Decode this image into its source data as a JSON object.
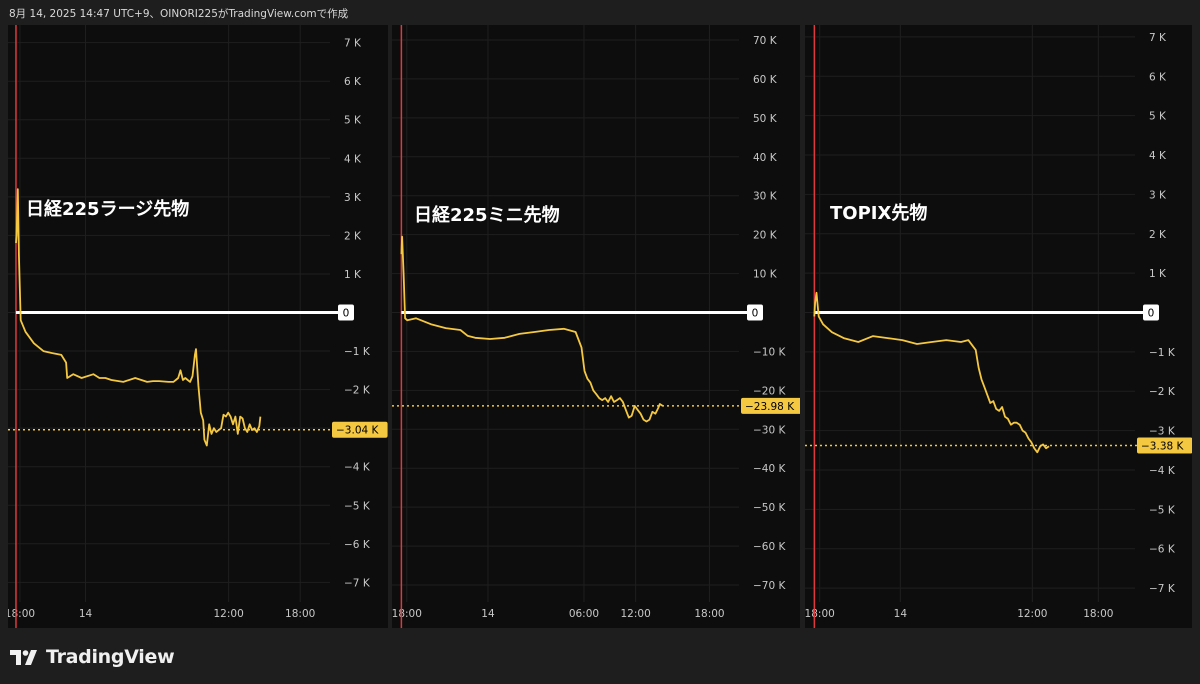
{
  "header": {
    "text": "8月 14, 2025 14:47 UTC+9、OINORI225がTradingView.comで作成"
  },
  "brand": {
    "name": "TradingView"
  },
  "colors": {
    "line": "#f5c842",
    "zero_line": "#ffffff",
    "session_line": "#e0383b",
    "grid": "#1f1f1f",
    "axis_text": "#c8c8c8",
    "panel_bg": "#0d0d0d",
    "page_bg": "#1e1e1e"
  },
  "chart_data": [
    {
      "type": "line",
      "title": "日経225ラージ先物",
      "y_ticks": [
        {
          "v": 7000,
          "label": "7 K"
        },
        {
          "v": 6000,
          "label": "6 K"
        },
        {
          "v": 5000,
          "label": "5 K"
        },
        {
          "v": 4000,
          "label": "4 K"
        },
        {
          "v": 3000,
          "label": "3 K"
        },
        {
          "v": 2000,
          "label": "2 K"
        },
        {
          "v": 1000,
          "label": "1 K"
        },
        {
          "v": 0,
          "label": "0"
        },
        {
          "v": -1000,
          "label": "−1 K"
        },
        {
          "v": -2000,
          "label": "−2 K"
        },
        {
          "v": -3000,
          "label": "−3 K"
        },
        {
          "v": -4000,
          "label": "−4 K"
        },
        {
          "v": -5000,
          "label": "−5 K"
        },
        {
          "v": -6000,
          "label": "−6 K"
        },
        {
          "v": -7000,
          "label": "−7 K"
        }
      ],
      "x_ticks": [
        {
          "t": 0.5,
          "label": "18:00"
        },
        {
          "t": 6,
          "label": "14"
        },
        {
          "t": 18,
          "label": "12:00"
        },
        {
          "t": 24,
          "label": "18:00"
        }
      ],
      "x_range": [
        -0.5,
        26.5
      ],
      "y_range": [
        -7250,
        7250
      ],
      "current_value": -3040,
      "current_label": "−3.04 K",
      "zero_label": "0",
      "series": [
        {
          "x": [
            0,
            0.05,
            0.15,
            0.25,
            0.4,
            0.8,
            1.5,
            2.3,
            3,
            3.8,
            4.2,
            4.3,
            4.8,
            5.5,
            6.5,
            7,
            7.5,
            8,
            9,
            10,
            11,
            11.5,
            12,
            12.8,
            13.2,
            13.4,
            13.6,
            13.8,
            14,
            14.2,
            14.4,
            14.6,
            14.8,
            15,
            15.1,
            15.3,
            15.5,
            15.7,
            15.8,
            16,
            16.2,
            16.4,
            16.6,
            16.8,
            17,
            17.2,
            17.4,
            17.6,
            17.8,
            18,
            18.2,
            18.4,
            18.6,
            18.8,
            19,
            19.2,
            19.4,
            19.6,
            19.8,
            20,
            20.2,
            20.4,
            20.5
          ],
          "y": [
            1800,
            2000,
            3200,
            1500,
            -200,
            -500,
            -800,
            -1000,
            -1050,
            -1100,
            -1300,
            -1700,
            -1600,
            -1700,
            -1600,
            -1700,
            -1700,
            -1750,
            -1800,
            -1700,
            -1800,
            -1780,
            -1780,
            -1800,
            -1800,
            -1750,
            -1700,
            -1500,
            -1750,
            -1700,
            -1750,
            -1800,
            -1650,
            -1100,
            -950,
            -1900,
            -2600,
            -2800,
            -3300,
            -3450,
            -2900,
            -3150,
            -3000,
            -3100,
            -3050,
            -3000,
            -2650,
            -2700,
            -2600,
            -2700,
            -2900,
            -2700,
            -3150,
            -2700,
            -2750,
            -3000,
            -3100,
            -2900,
            -3050,
            -3000,
            -3100,
            -2950,
            -2700
          ]
        }
      ]
    },
    {
      "type": "line",
      "title": "日経225ミニ先物",
      "y_ticks": [
        {
          "v": 70000,
          "label": "70 K"
        },
        {
          "v": 60000,
          "label": "60 K"
        },
        {
          "v": 50000,
          "label": "50 K"
        },
        {
          "v": 40000,
          "label": "40 K"
        },
        {
          "v": 30000,
          "label": "30 K"
        },
        {
          "v": 20000,
          "label": "20 K"
        },
        {
          "v": 10000,
          "label": "10 K"
        },
        {
          "v": 0,
          "label": "0"
        },
        {
          "v": -10000,
          "label": "−10 K"
        },
        {
          "v": -20000,
          "label": "−20 K"
        },
        {
          "v": -30000,
          "label": "−30 K"
        },
        {
          "v": -40000,
          "label": "−40 K"
        },
        {
          "v": -50000,
          "label": "−50 K"
        },
        {
          "v": -60000,
          "label": "−60 K"
        },
        {
          "v": -70000,
          "label": "−70 K"
        }
      ],
      "x_ticks": [
        {
          "t": 0.5,
          "label": "18:00"
        },
        {
          "t": 6,
          "label": "14"
        },
        {
          "t": 12.5,
          "label": "06:00"
        },
        {
          "t": 16,
          "label": "12:00"
        },
        {
          "t": 21,
          "label": "18:00"
        }
      ],
      "x_range": [
        -0.5,
        23
      ],
      "y_range": [
        -71800,
        71800
      ],
      "current_value": -23980,
      "current_label": "−23.98 K",
      "zero_label": "0",
      "series": [
        {
          "x": [
            0,
            0.05,
            0.15,
            0.25,
            0.4,
            1,
            2,
            3,
            4,
            4.5,
            5,
            6,
            7,
            8,
            9,
            10,
            11,
            11.8,
            12.2,
            12.4,
            12.6,
            12.8,
            13,
            13.2,
            13.4,
            13.6,
            13.8,
            14,
            14.2,
            14.4,
            14.6,
            14.8,
            15,
            15.2,
            15.4,
            15.6,
            15.8,
            16,
            16.2,
            16.4,
            16.6,
            16.8,
            17,
            17.2,
            17.4,
            17.5,
            17.7
          ],
          "y": [
            15000,
            19500,
            10000,
            -1500,
            -2000,
            -1500,
            -3000,
            -4000,
            -4500,
            -6000,
            -6500,
            -6800,
            -6500,
            -5500,
            -5000,
            -4500,
            -4200,
            -5000,
            -9000,
            -15000,
            -17000,
            -18000,
            -20000,
            -21000,
            -22000,
            -22500,
            -22000,
            -23000,
            -21500,
            -23000,
            -22500,
            -22000,
            -23000,
            -25000,
            -27000,
            -26500,
            -24000,
            -25000,
            -26000,
            -27500,
            -28000,
            -27500,
            -25500,
            -26000,
            -24500,
            -23500,
            -24000
          ]
        }
      ]
    },
    {
      "type": "line",
      "title": "TOPIX先物",
      "y_ticks": [
        {
          "v": 7000,
          "label": "7 K"
        },
        {
          "v": 6000,
          "label": "6 K"
        },
        {
          "v": 5000,
          "label": "5 K"
        },
        {
          "v": 4000,
          "label": "4 K"
        },
        {
          "v": 3000,
          "label": "3 K"
        },
        {
          "v": 2000,
          "label": "2 K"
        },
        {
          "v": 1000,
          "label": "1 K"
        },
        {
          "v": 0,
          "label": "0"
        },
        {
          "v": -1000,
          "label": "−1 K"
        },
        {
          "v": -2000,
          "label": "−2 K"
        },
        {
          "v": -3000,
          "label": "−3 K"
        },
        {
          "v": -4000,
          "label": "−4 K"
        },
        {
          "v": -5000,
          "label": "−5 K"
        },
        {
          "v": -6000,
          "label": "−6 K"
        },
        {
          "v": -7000,
          "label": "−7 K"
        }
      ],
      "x_ticks": [
        {
          "t": 0.5,
          "label": "18:00"
        },
        {
          "t": 6,
          "label": "14"
        },
        {
          "t": 15,
          "label": "12:00"
        },
        {
          "t": 19.5,
          "label": "18:00"
        }
      ],
      "x_range": [
        -0.5,
        22
      ],
      "y_range": [
        -7100,
        7100
      ],
      "current_value": -3380,
      "current_label": "−3.38 K",
      "zero_label": "0",
      "series": [
        {
          "x": [
            0,
            0.05,
            0.15,
            0.3,
            0.6,
            1.2,
            2,
            3,
            4,
            5,
            6,
            7,
            8,
            9,
            10,
            10.5,
            11,
            11.2,
            11.4,
            11.6,
            11.8,
            12,
            12.2,
            12.4,
            12.6,
            12.8,
            13,
            13.2,
            13.4,
            13.6,
            13.8,
            14,
            14.2,
            14.4,
            14.6,
            14.8,
            15,
            15.2,
            15.4,
            15.6,
            15.8,
            16
          ],
          "y": [
            -100,
            250,
            500,
            -100,
            -300,
            -500,
            -650,
            -750,
            -600,
            -650,
            -700,
            -800,
            -750,
            -700,
            -750,
            -700,
            -950,
            -1400,
            -1700,
            -1900,
            -2100,
            -2300,
            -2250,
            -2450,
            -2500,
            -2400,
            -2650,
            -2700,
            -2850,
            -2800,
            -2800,
            -2850,
            -3000,
            -3050,
            -3200,
            -3300,
            -3450,
            -3550,
            -3400,
            -3350,
            -3450,
            -3400
          ]
        }
      ]
    }
  ]
}
